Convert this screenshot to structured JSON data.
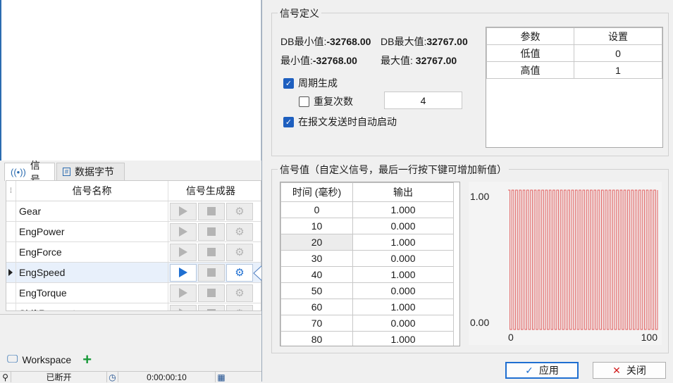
{
  "left_panel": {
    "tabs": [
      {
        "icon": "signal-icon",
        "label": "信号"
      },
      {
        "icon": "hash-icon",
        "label": "数据字节"
      }
    ],
    "grid": {
      "headers": {
        "indicator": "⁞",
        "name": "信号名称",
        "generator": "信号生成器"
      },
      "rows": [
        {
          "name": "Gear",
          "selected": false
        },
        {
          "name": "EngPower",
          "selected": false
        },
        {
          "name": "EngForce",
          "selected": false
        },
        {
          "name": "EngSpeed",
          "selected": true
        },
        {
          "name": "EngTorque",
          "selected": false
        },
        {
          "name": "ShiftRequest",
          "selected": false
        }
      ]
    },
    "workspace_tab": "Workspace",
    "status": {
      "connection": "已断开",
      "time": "0:00:00:10"
    }
  },
  "definition": {
    "title": "信号定义",
    "db_min_label": "DB最小值:",
    "db_min_value": "-32768.00",
    "db_max_label": "DB最大值:",
    "db_max_value": "32767.00",
    "min_label": "最小值:",
    "min_value": "-32768.00",
    "max_label": "最大值:",
    "max_value": "32767.00",
    "periodic_label": "周期生成",
    "periodic_checked": true,
    "repeat_label": "重复次数",
    "repeat_checked": false,
    "repeat_value": "4",
    "autostart_label": "在报文发送时自动启动",
    "autostart_checked": true,
    "param_table": {
      "headers": [
        "参数",
        "设置"
      ],
      "rows": [
        [
          "低值",
          "0"
        ],
        [
          "高值",
          "1"
        ]
      ]
    }
  },
  "values": {
    "title": "信号值（自定义信号，最后一行按下键可增加新值）",
    "table": {
      "headers": [
        "时间 (毫秒)",
        "输出"
      ],
      "rows": [
        [
          "0",
          "1.000"
        ],
        [
          "10",
          "0.000"
        ],
        [
          "20",
          "1.000"
        ],
        [
          "30",
          "0.000"
        ],
        [
          "40",
          "1.000"
        ],
        [
          "50",
          "0.000"
        ],
        [
          "60",
          "1.000"
        ],
        [
          "70",
          "0.000"
        ],
        [
          "80",
          "1.000"
        ]
      ]
    }
  },
  "chart_data": {
    "type": "line",
    "title": "",
    "xlabel": "",
    "ylabel": "",
    "xlim": [
      0,
      100
    ],
    "ylim": [
      0.0,
      1.0
    ],
    "x_ticks": [
      "0",
      "100"
    ],
    "y_ticks": [
      "1.00",
      "0.00"
    ],
    "series": [
      {
        "color": "#e05a5a",
        "period_ms": 20,
        "low": 0,
        "high": 1
      }
    ]
  },
  "buttons": {
    "apply": "应用",
    "close": "关闭"
  },
  "colors": {
    "accent": "#1f6fd1",
    "signal": "#e05a5a"
  }
}
